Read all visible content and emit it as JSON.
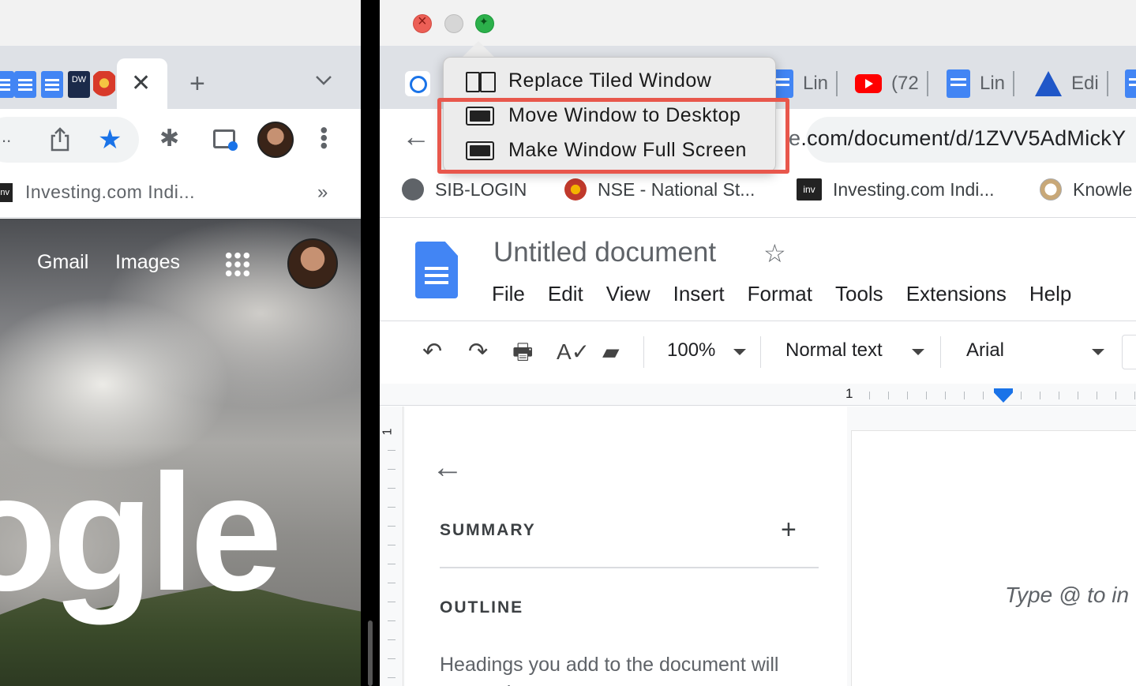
{
  "left_window": {
    "favicon_dw_text": "DW",
    "bookmark_icon_text": "inv",
    "bookmark_text": "Investing.com Indi...",
    "bookmarks_more": "»",
    "tab_close": "✕",
    "new_tab": "+",
    "tab_search": "⌄",
    "star": "★",
    "puzzle": "✱",
    "page": {
      "gmail_link": "Gmail",
      "images_link": "Images",
      "logo_text": "ogle"
    }
  },
  "right_window": {
    "tabs": [
      {
        "label": "Lin",
        "icon": "docs-icon"
      },
      {
        "label": "(72",
        "icon": "youtube-icon"
      },
      {
        "label": "Lin",
        "icon": "docs-icon"
      },
      {
        "label": "Edi",
        "icon": "triangle-icon"
      }
    ],
    "back": "←",
    "url_prefix": "e",
    "url_rest": ".com/document/d/1ZVV5AdMickY",
    "bookmarks": [
      {
        "label": "SIB-LOGIN"
      },
      {
        "label": "NSE - National St..."
      },
      {
        "label": "Investing.com Indi...",
        "icon_text": "inv"
      },
      {
        "label": "Knowle"
      }
    ],
    "docs": {
      "title": "Untitled document",
      "star": "☆",
      "menu": [
        "File",
        "Edit",
        "View",
        "Insert",
        "Format",
        "Tools",
        "Extensions",
        "Help"
      ],
      "toolbar": {
        "undo": "↶",
        "redo": "↷",
        "print": "🖶",
        "spell": "A✓",
        "paint": "▰",
        "zoom": "100%",
        "style": "Normal text",
        "font": "Arial"
      },
      "ruler_number": "1",
      "vertical_ruler_number": "1",
      "outline": {
        "back": "←",
        "summary_label": "SUMMARY",
        "summary_add": "+",
        "outline_label": "OUTLINE",
        "hint": "Headings you add to the document will appear here."
      },
      "page_placeholder": "Type @ to in"
    }
  },
  "window_menu": {
    "items": [
      {
        "label": "Replace Tiled Window",
        "icon": "tile-windows-icon"
      },
      {
        "label": "Move Window to Desktop",
        "icon": "window-icon"
      },
      {
        "label": "Make Window Full Screen",
        "icon": "fullscreen-icon"
      }
    ],
    "highlight_color": "#e8574c"
  }
}
